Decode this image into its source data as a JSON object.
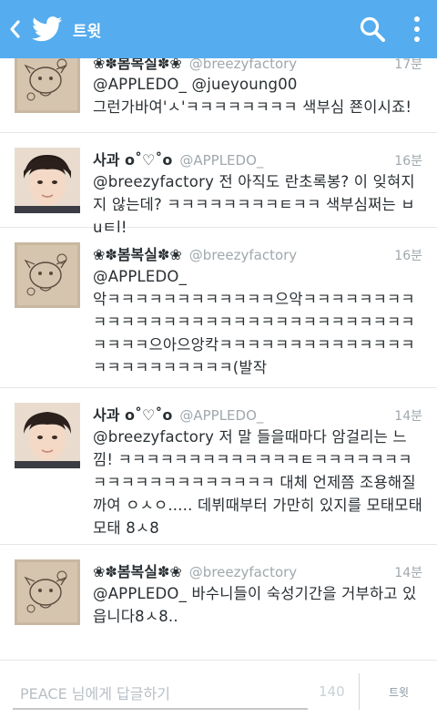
{
  "header": {
    "title": "트윗",
    "back_icon": "chevron-left-icon",
    "logo_icon": "twitter-bird-icon",
    "search_icon": "search-icon",
    "menu_icon": "more-vertical-icon",
    "color": "#55acee"
  },
  "tweets": [
    {
      "name": "❀✽봄복실✽❀",
      "handle": "@breezyfactory",
      "time": "17분",
      "text": "@APPLEDO_ @jueyoung00\n그런가바여'ㅅ'ㅋㅋㅋㅋㅋㅋㅋㅋ 색부심 쬰이시죠!",
      "avatar": "sketch-drawing-avatar"
    },
    {
      "name": "사과 o˚♡˚o",
      "handle": "@APPLEDO_",
      "time": "16분",
      "text": "@breezyfactory 전 아직도 란초록봉? 이 잊혀지지 않는데? ㅋㅋㅋㅋㅋㅋㅋㅋㅌㅋㅋ 색부심쩌는 ㅂuㅌl!",
      "avatar": "portrait-photo-avatar"
    },
    {
      "name": "❀✽봄복실✽❀",
      "handle": "@breezyfactory",
      "time": "16분",
      "text": "@APPLEDO_\n악ㅋㅋㅋㅋㅋㅋㅋㅋㅋㅋㅋㅋ으악ㅋㅋㅋㅋㅋㅋㅋㅋㅋㅋㅋㅋㅋㅋㅋㅋㅋㅋㅋㅋㅋㅋㅋㅋㅋㅋㅋㅋㅋㅋㅋㅋㅋㅋㅋ으아으앙칵ㅋㅋㅋㅋㅋㅋㅋㅋㅋㅋㅋㅋㅋㅋㅋㅋㅋㅋㅋㅋㅋㅋㅋㅋ(발작",
      "avatar": "sketch-drawing-avatar"
    },
    {
      "name": "사과 o˚♡˚o",
      "handle": "@APPLEDO_",
      "time": "14분",
      "text": "@breezyfactory 저 말 들을때마다 암걸리는 느낌! ㅋㅋㅋㅋㅋㅋㅋㅋㅋㅋㅋㅋㅋㅌㅋㅋㅋㅋㅋㅋㅋㅋㅋㅋㅋㅋㅋㅋㅋㅋㅋㅋㅋㅋ 대체 언제쯤 조용해질까여 ㅇㅅㅇ..... 데뷔때부터 가만히 있지를 모태모태모태 8ㅅ8",
      "avatar": "portrait-photo-avatar"
    },
    {
      "name": "❀✽봄복실✽❀",
      "handle": "@breezyfactory",
      "time": "14분",
      "text": "@APPLEDO_ 바수니들이 숙성기간을 거부하고 있읍니다8ㅅ8..",
      "avatar": "sketch-drawing-avatar"
    }
  ],
  "reply": {
    "placeholder": "PEACE 님에게 답글하기",
    "value": "",
    "counter": "140",
    "button_label": "트윗"
  }
}
